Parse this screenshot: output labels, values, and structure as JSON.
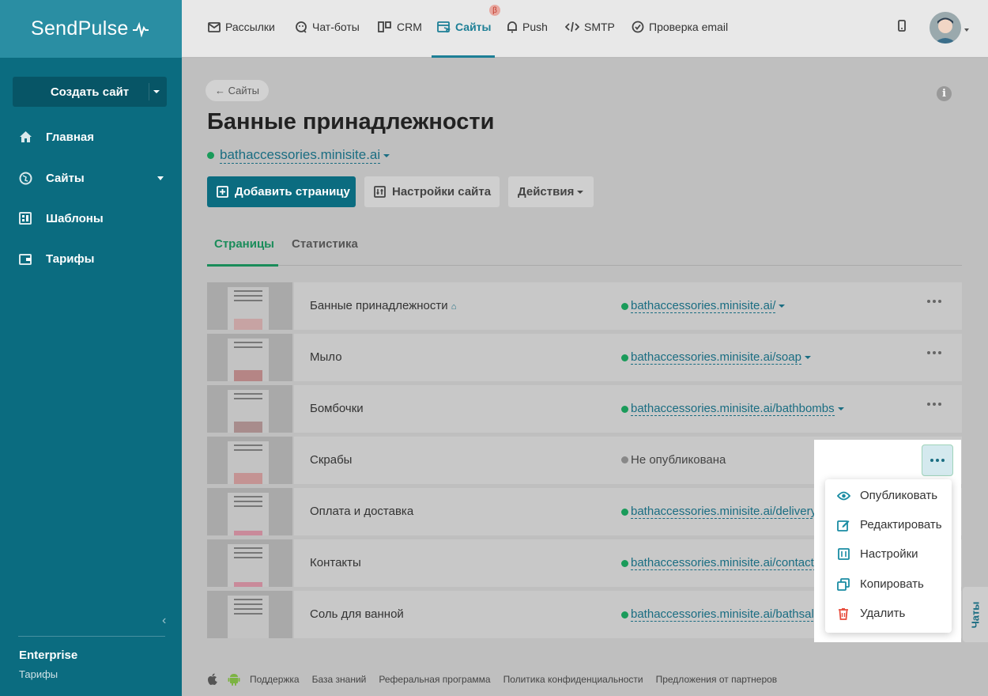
{
  "sidebar": {
    "logo": "SendPulse",
    "create_button": "Создать сайт",
    "items": [
      {
        "label": "Главная",
        "icon": "home-icon"
      },
      {
        "label": "Сайты",
        "icon": "globe-icon"
      },
      {
        "label": "Шаблоны",
        "icon": "templates-icon"
      },
      {
        "label": "Тарифы",
        "icon": "wallet-icon"
      }
    ],
    "plan_name": "Enterprise",
    "plan_link": "Тарифы"
  },
  "topnav": {
    "items": [
      {
        "label": "Рассылки",
        "icon": "mail-icon"
      },
      {
        "label": "Чат-боты",
        "icon": "chatbot-icon"
      },
      {
        "label": "CRM",
        "icon": "crm-icon"
      },
      {
        "label": "Сайты",
        "icon": "sites-icon"
      },
      {
        "label": "Push",
        "icon": "bell-icon"
      },
      {
        "label": "SMTP",
        "icon": "code-icon"
      },
      {
        "label": "Проверка email",
        "icon": "check-circle-icon"
      }
    ],
    "active": "Сайты",
    "beta_badge": "β"
  },
  "main": {
    "back_label": "← Сайты",
    "title": "Банные принадлежности",
    "domain": "bathaccessories.minisite.ai",
    "buttons": {
      "add_page": "Добавить страницу",
      "site_settings": "Настройки сайта",
      "actions": "Действия"
    },
    "tabs": [
      "Страницы",
      "Статистика"
    ],
    "rows": [
      {
        "name": "Банные принадлежности",
        "url": "bathaccessories.minisite.ai/",
        "published": true,
        "home": true
      },
      {
        "name": "Мыло",
        "url": "bathaccessories.minisite.ai/soap",
        "published": true
      },
      {
        "name": "Бомбочки",
        "url": "bathaccessories.minisite.ai/bathbombs",
        "published": true
      },
      {
        "name": "Скрабы",
        "url": "Не опубликована",
        "published": false
      },
      {
        "name": "Оплата и доставка",
        "url": "bathaccessories.minisite.ai/delivery",
        "published": true
      },
      {
        "name": "Контакты",
        "url": "bathaccessories.minisite.ai/contacts",
        "published": true
      },
      {
        "name": "Соль для ванной",
        "url": "bathaccessories.minisite.ai/bathsalt",
        "published": true
      }
    ],
    "row_menu": [
      {
        "label": "Опубликовать",
        "icon": "eye-icon"
      },
      {
        "label": "Редактировать",
        "icon": "edit-icon"
      },
      {
        "label": "Настройки",
        "icon": "settings-icon"
      },
      {
        "label": "Копировать",
        "icon": "copy-icon"
      },
      {
        "label": "Удалить",
        "icon": "trash-icon"
      }
    ],
    "chats_tab": "Чаты"
  },
  "footer": {
    "links": [
      "Поддержка",
      "База знаний",
      "Реферальная программа",
      "Политика конфиденциальности",
      "Предложения от партнеров"
    ]
  },
  "colors": {
    "sidebar": "#0b6c80",
    "accent": "#1a6d82",
    "green": "#1a9b5a",
    "danger": "#e74c3c"
  }
}
